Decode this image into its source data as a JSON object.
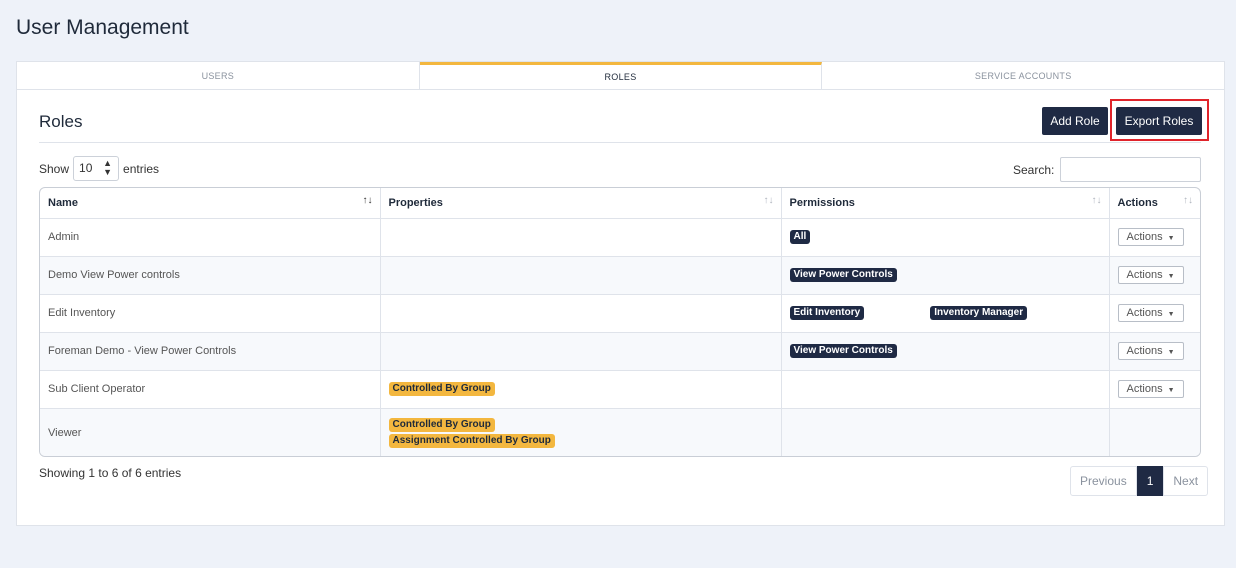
{
  "page_title": "User Management",
  "tabs": [
    {
      "label": "USERS"
    },
    {
      "label": "ROLES"
    },
    {
      "label": "SERVICE ACCOUNTS"
    }
  ],
  "active_tab": "ROLES",
  "section_title": "Roles",
  "buttons": {
    "add_role": "Add Role",
    "export_roles": "Export Roles"
  },
  "length_control": {
    "show_label": "Show",
    "value": "10",
    "entries_label": "entries"
  },
  "search": {
    "label": "Search:",
    "value": ""
  },
  "table": {
    "columns": [
      "Name",
      "Properties",
      "Permissions",
      "Actions"
    ],
    "sorted_column": "Name",
    "rows": [
      {
        "name": "Admin",
        "properties": [],
        "permissions": [
          "All"
        ],
        "action": "Actions"
      },
      {
        "name": "Demo View Power controls",
        "properties": [],
        "permissions": [
          "View Power Controls"
        ],
        "action": "Actions"
      },
      {
        "name": "Edit Inventory",
        "properties": [],
        "permissions": [
          "Edit Inventory",
          "Inventory Manager"
        ],
        "action": "Actions"
      },
      {
        "name": "Foreman Demo - View Power Controls",
        "properties": [],
        "permissions": [
          "View Power Controls"
        ],
        "action": "Actions"
      },
      {
        "name": "Sub Client Operator",
        "properties": [
          "Controlled By Group"
        ],
        "permissions": [],
        "action": "Actions"
      },
      {
        "name": "Viewer",
        "properties": [
          "Controlled By Group",
          "Assignment Controlled By Group"
        ],
        "permissions": [],
        "action": ""
      }
    ]
  },
  "info_text": "Showing 1 to 6 of 6 entries",
  "pagination": {
    "previous": "Previous",
    "current": "1",
    "next": "Next"
  },
  "colors": {
    "accent": "#f3b73f",
    "primary": "#1f2a44",
    "highlight": "#e0242b"
  }
}
